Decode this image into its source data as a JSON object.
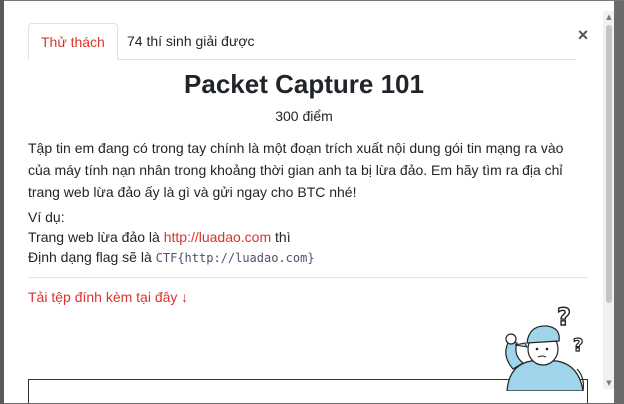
{
  "tabs": [
    {
      "label": "Thử thách",
      "active": true
    },
    {
      "label": "74 thí sinh giải được",
      "active": false
    }
  ],
  "close_label": "×",
  "challenge": {
    "title": "Packet Capture 101",
    "points": "300 điểm",
    "description": "Tập tin em đang có trong tay chính là một đoạn trích xuất nội dung gói tin mạng ra vào của máy tính nạn nhân trong khoảng thời gian anh ta bị lừa đảo. Em hãy tìm ra địa chỉ trang web lừa đảo ấy là gì và gửi ngay cho BTC nhé!",
    "example_heading": "Ví dụ:",
    "example_line1_prefix": "Trang web lừa đảo là ",
    "example_url": "http://luadao.com",
    "example_line1_suffix": " thì",
    "example_line2_prefix": "Định dạng flag sẽ là ",
    "example_flag": "CTF{http://luadao.com}",
    "attachment_label": "Tải tệp đính kèm tại đây ↓"
  },
  "icons": {
    "close": "close-icon",
    "mascot": "confused-person-illustration"
  },
  "colors": {
    "accent": "#d9342b",
    "text": "#212529",
    "backdrop": "#6b6b6b"
  }
}
